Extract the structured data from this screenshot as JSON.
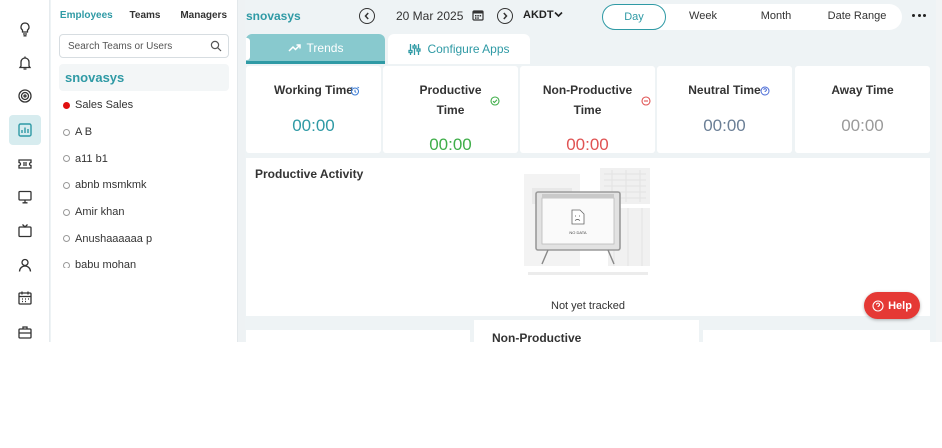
{
  "colors": {
    "accent": "#2f9aa5",
    "productive": "#3fae49",
    "non_productive": "#e05353",
    "neutral": "#6b7f96",
    "away": "#9a9a9a",
    "help": "#e53935"
  },
  "rail": {
    "icons": [
      "lightbulb-icon",
      "alarm-icon",
      "target-icon",
      "chart-icon",
      "ticket-icon",
      "monitor-icon",
      "tv-icon",
      "user-icon",
      "calendar-icon",
      "briefcase-icon"
    ],
    "active": "chart-icon"
  },
  "panel": {
    "tabs": [
      "Employees",
      "Teams",
      "Managers"
    ],
    "active_tab": "Employees",
    "search_placeholder": "Search Teams or Users",
    "group": "snovasys",
    "items": [
      {
        "name": "Sales Sales",
        "status": "red"
      },
      {
        "name": "A B",
        "status": "empty"
      },
      {
        "name": "a11 b1",
        "status": "empty"
      },
      {
        "name": "abnb msmkmk",
        "status": "empty"
      },
      {
        "name": "Amir khan",
        "status": "empty"
      },
      {
        "name": "Anushaaaaaa p",
        "status": "empty"
      },
      {
        "name": "babu mohan",
        "status": "empty"
      }
    ]
  },
  "header": {
    "org": "snovasys",
    "date": "20 Mar 2025",
    "timezone": "AKDT",
    "ranges": [
      "Day",
      "Week",
      "Month",
      "Date Range"
    ],
    "active_range": "Day"
  },
  "subtabs": {
    "trends": "Trends",
    "configure": "Configure Apps"
  },
  "metrics": {
    "working": {
      "title": "Working Time",
      "value": "00:00"
    },
    "productive": {
      "title_line1": "Productive",
      "title_line2": "Time",
      "value": "00:00"
    },
    "non_productive": {
      "title_line1": "Non-Productive",
      "title_line2": "Time",
      "value": "00:00"
    },
    "neutral": {
      "title": "Neutral Time",
      "value": "00:00"
    },
    "away": {
      "title": "Away Time",
      "value": "00:00"
    }
  },
  "activity": {
    "title": "Productive Activity",
    "nodata_art_text": "NO DATA",
    "message": "Not yet tracked"
  },
  "bottom": {
    "middle_title": "Non-Productive"
  },
  "help": {
    "label": "Help"
  }
}
